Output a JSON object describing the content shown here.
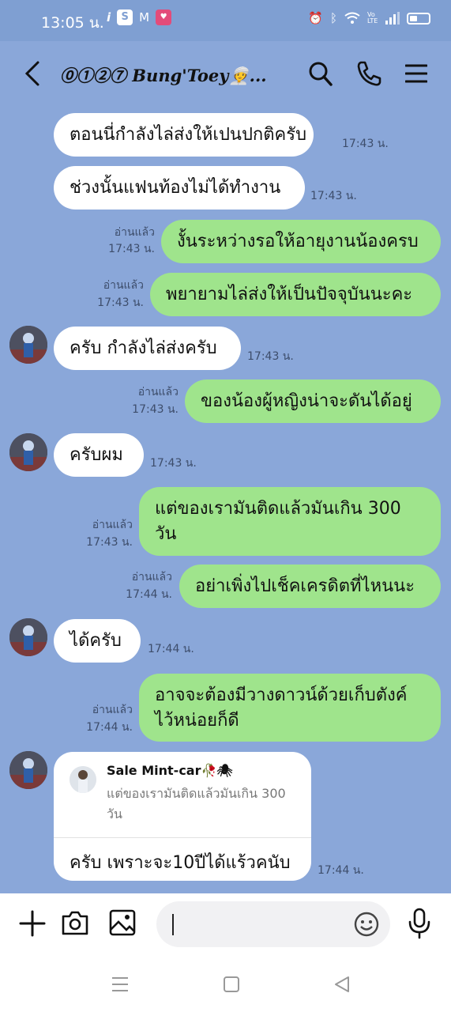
{
  "status_bar": {
    "time": "13:05 น.",
    "app_icons": [
      "info-icon",
      "s-app-icon",
      "gmail-icon",
      "line-app-icon"
    ],
    "right_icons": [
      "alarm-icon",
      "bluetooth-icon",
      "wifi-icon",
      "volte-icon",
      "signal-icon",
      "battery-icon"
    ],
    "battery_level": 0.4,
    "volte_label": "Vo LTE"
  },
  "header": {
    "title": "⓪①②⑦ Bung'Toey👳‍♀️..."
  },
  "messages": [
    {
      "side": "left",
      "text": "ตอนนี่กำลังไล่ส่งให้เปนปกติครับ",
      "time": "17:43 น."
    },
    {
      "side": "left",
      "text": "ช่วงนั้นแฟนท้องไม่ได้ทำงาน",
      "time": "17:43 น."
    },
    {
      "side": "right",
      "text": "งั้นระหว่างรอให้อายุงานน้องครบ",
      "read": "อ่านแล้ว",
      "time": "17:43 น."
    },
    {
      "side": "right",
      "text": "พยายามไล่ส่งให้เป็นปัจจุบันนะคะ",
      "read": "อ่านแล้ว",
      "time": "17:43 น."
    },
    {
      "side": "left",
      "text": "ครับ กำลังไล่ส่งครับ",
      "time": "17:43 น."
    },
    {
      "side": "right",
      "text": "ของน้องผู้หญิงน่าจะดันได้อยู่",
      "read": "อ่านแล้ว",
      "time": "17:43 น."
    },
    {
      "side": "left",
      "text": "ครับผม",
      "time": "17:43 น."
    },
    {
      "side": "right",
      "line1": "แต่ของเรามันติดแล้วมันเกิน 300",
      "line2": "วัน",
      "read": "อ่านแล้ว",
      "time": "17:43 น."
    },
    {
      "side": "right",
      "text": "อย่าเพิ่งไปเช็คเครดิตที่ไหนนะ",
      "read": "อ่านแล้ว",
      "time": "17:44 น."
    },
    {
      "side": "left",
      "text": "ได้ครับ",
      "time": "17:44 น."
    },
    {
      "side": "right",
      "line1": "อาจจะต้องมีวางดาวน์ด้วยเก็บตังค์",
      "line2": "ไว้หน่อยก็ดี",
      "read": "อ่านแล้ว",
      "time": "17:44 น."
    }
  ],
  "reply": {
    "quoted_name": "Sale Mint-car🥀🕷",
    "quoted_text": "แต่ของเรามันติดแล้วมันเกิน 300 วัน",
    "text": "ครับ เพราะจะ10ปีได้แร้วคนับ",
    "time": "17:44 น."
  },
  "input_bar": {
    "placeholder": "",
    "icons": [
      "plus-icon",
      "camera-icon",
      "image-icon",
      "emoji-icon",
      "microphone-icon"
    ]
  },
  "nav_bar": {
    "icons": [
      "menu-nav-icon",
      "home-nav-icon",
      "back-nav-icon"
    ]
  },
  "colors": {
    "chat_background": "#8aa7d9",
    "sent_bubble": "#9fe48c",
    "received_bubble": "#ffffff"
  }
}
